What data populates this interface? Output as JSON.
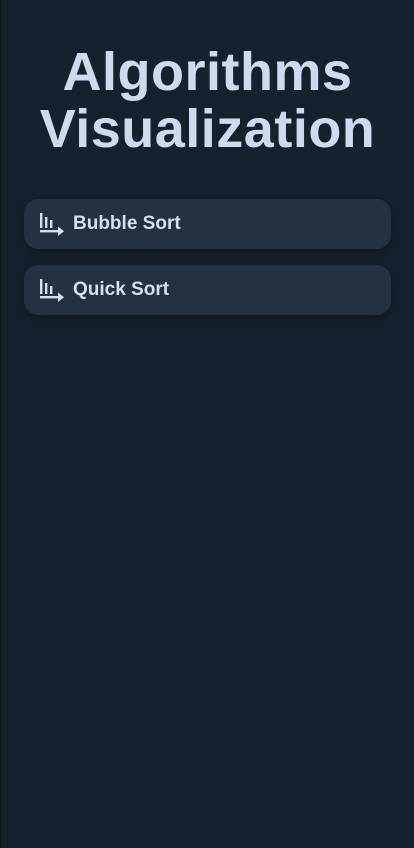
{
  "page": {
    "title_line1": "Algorithms",
    "title_line2": "Visualization"
  },
  "menu": {
    "items": [
      {
        "label": "Bubble Sort",
        "icon": "bar-chart-arrow-icon"
      },
      {
        "label": "Quick Sort",
        "icon": "bar-chart-arrow-icon"
      }
    ]
  },
  "colors": {
    "background": "#16212f",
    "card": "#233142",
    "text": "#d3dcee"
  }
}
